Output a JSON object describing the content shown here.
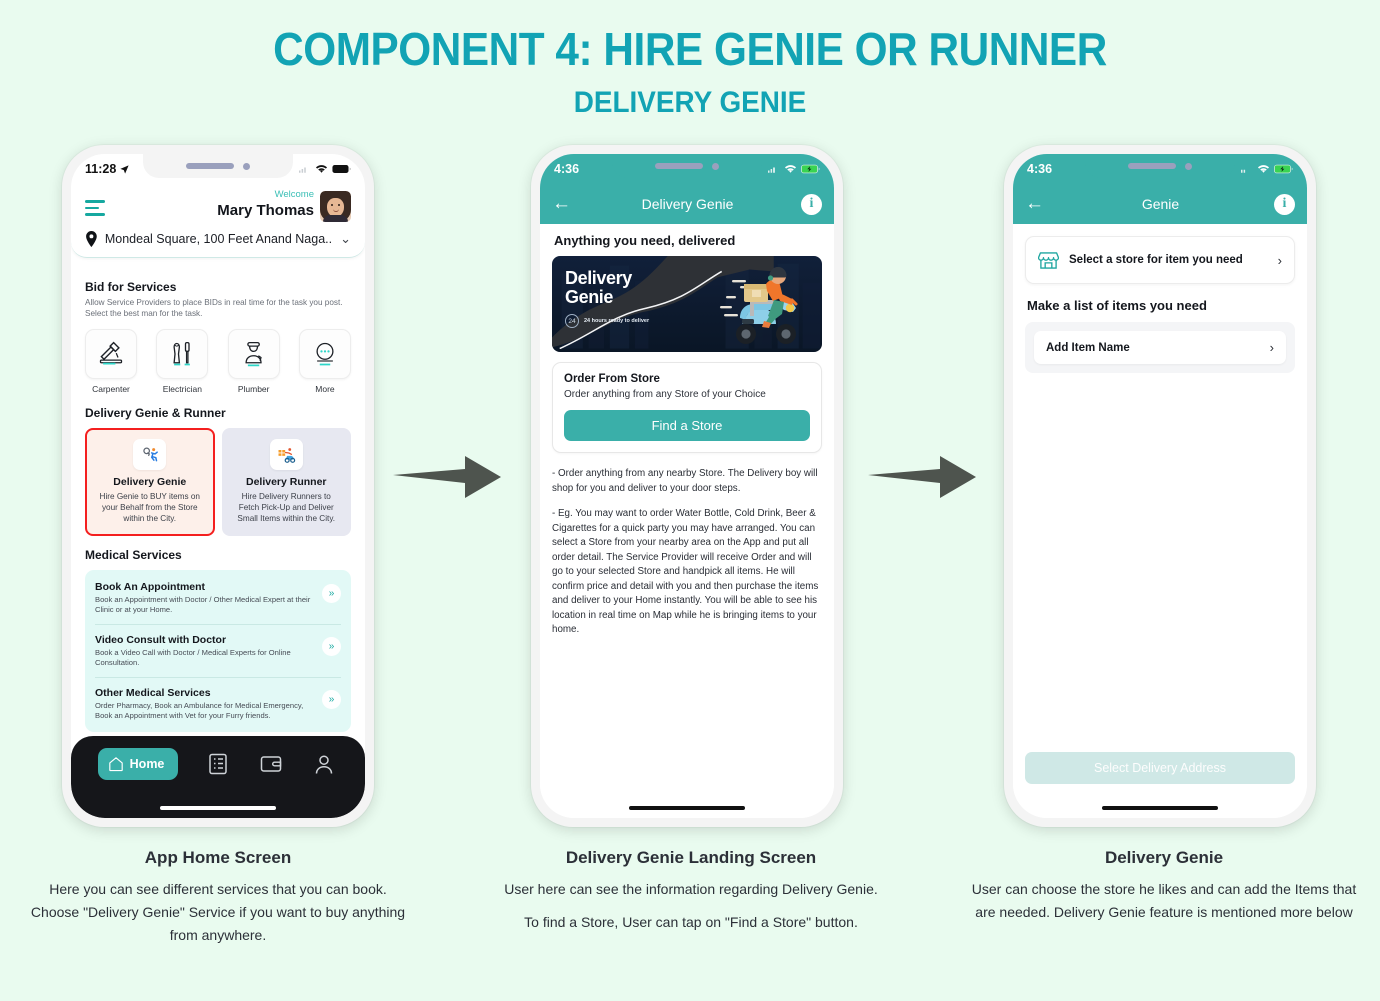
{
  "header": {
    "title": "COMPONENT 4: HIRE GENIE OR RUNNER",
    "subtitle": "DELIVERY GENIE"
  },
  "colors": {
    "page_bg": "#e9fbef",
    "title_teal": "#12a3b4",
    "app_teal": "#3aafa9",
    "highlight_red": "#f41f1f",
    "banner_dark": "#0d1a2e"
  },
  "phone1": {
    "status": {
      "time": "11:28",
      "location_arrow": "➤",
      "wifi": "wifi-icon",
      "battery": "battery-icon"
    },
    "menu_icon": "hamburger-icon",
    "welcome_label": "Welcome",
    "user_name": "Mary Thomas",
    "avatar": "user-avatar",
    "location": "Mondeal Square, 100 Feet Anand Naga...",
    "location_chevron": "⌄",
    "bid_section": {
      "title": "Bid for Services",
      "description": "Allow Service Providers to place BIDs in real time for the task you post. Select the best man for the task.",
      "services": [
        {
          "label": "Carpenter",
          "icon": "hammer-icon"
        },
        {
          "label": "Electrician",
          "icon": "pliers-screwdriver-icon"
        },
        {
          "label": "Plumber",
          "icon": "plumber-worker-icon"
        },
        {
          "label": "More",
          "icon": "more-dots-icon"
        }
      ]
    },
    "genie_section": {
      "title": "Delivery Genie & Runner",
      "cards": [
        {
          "title": "Delivery Genie",
          "desc": "Hire Genie to BUY items on your Behalf from the Store within the City.",
          "icon": "running-person-icon",
          "selected": true
        },
        {
          "title": "Delivery Runner",
          "desc": "Hire Delivery Runners to Fetch Pick-Up and Deliver Small Items within the City.",
          "icon": "scooter-box-icon",
          "selected": false
        }
      ]
    },
    "medical_section": {
      "title": "Medical Services",
      "items": [
        {
          "title": "Book An Appointment",
          "desc": "Book an Appointment with Doctor / Other Medical Expert at their Clinic or at your Home."
        },
        {
          "title": "Video Consult with Doctor",
          "desc": "Book a Video Call with Doctor / Medical Experts for Online Consultation."
        },
        {
          "title": "Other Medical Services",
          "desc": "Order Pharmacy, Book an Ambulance for Medical Emergency, Book an Appointment with Vet for your Furry friends."
        }
      ]
    },
    "tabbar": {
      "home_label": "Home",
      "tabs": [
        "home-icon",
        "list-icon",
        "wallet-icon",
        "profile-icon"
      ]
    }
  },
  "phone2": {
    "status": {
      "time": "4:36",
      "signal": "signal-icon",
      "wifi": "wifi-icon",
      "battery": "battery-charging-icon"
    },
    "appbar": {
      "back": "back-arrow-icon",
      "title": "Delivery Genie",
      "info": "info-icon"
    },
    "heading": "Anything you need, delivered",
    "banner": {
      "title_line1": "Delivery",
      "title_line2": "Genie",
      "badge_number": "24",
      "badge_text": "24 hours ready to deliver",
      "illustration": "scooter-delivery-illustration"
    },
    "order_card": {
      "title": "Order From Store",
      "desc": "Order anything from any Store of your Choice",
      "button": "Find a Store"
    },
    "paragraph_1": "- Order anything from any nearby Store. The Delivery boy will shop for you and deliver to your door steps.",
    "paragraph_2": "- Eg. You may want to order Water Bottle, Cold Drink, Beer & Cigarettes for a quick party you may have arranged. You can select a Store from your nearby area on the App and put all order detail. The Service Provider will receive Order and will go to your selected Store and handpick all items. He will confirm price and detail with you and then purchase the items and deliver to your Home instantly. You will be able to see his location in real time on Map while he is bringing items to your home."
  },
  "phone3": {
    "status": {
      "time": "4:36",
      "signal": "signal-icon",
      "wifi": "wifi-icon",
      "battery": "battery-charging-icon"
    },
    "appbar": {
      "back": "back-arrow-icon",
      "title": "Genie",
      "info": "info-icon"
    },
    "store_row": {
      "icon": "storefront-icon",
      "label": "Select a store for item you need",
      "chevron": "›"
    },
    "list_heading": "Make a list of items you need",
    "add_item": {
      "label": "Add Item Name",
      "chevron": "›"
    },
    "address_button": "Select Delivery Address"
  },
  "captions": [
    {
      "title": "App Home Screen",
      "paragraphs": [
        "Here you can see different services that you can book. Choose \"Delivery Genie\" Service if you want to buy anything from anywhere."
      ]
    },
    {
      "title": "Delivery Genie Landing Screen",
      "paragraphs": [
        "User here can see the information regarding Delivery Genie.",
        "To find a Store, User can tap on \"Find a Store\" button."
      ]
    },
    {
      "title": "Delivery Genie",
      "paragraphs": [
        "User can choose the store he likes and can add the Items that are needed. Delivery Genie feature is mentioned more below"
      ]
    }
  ]
}
